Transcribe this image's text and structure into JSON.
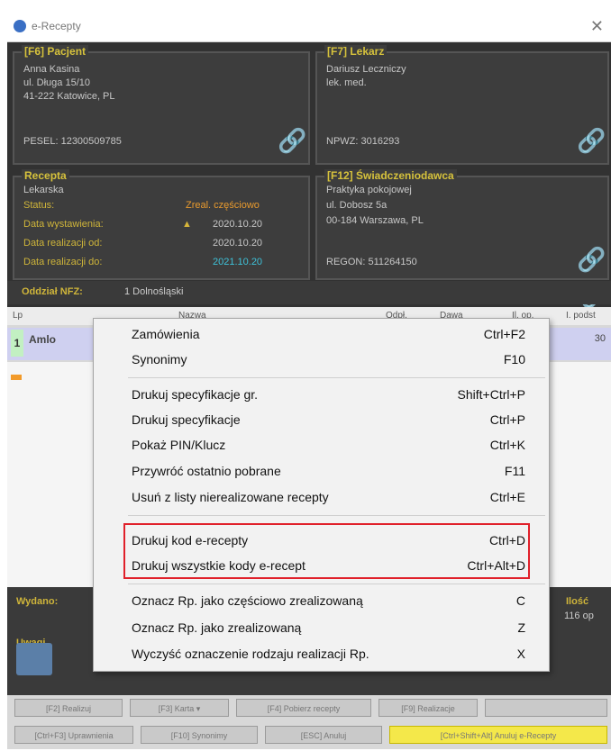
{
  "window": {
    "title": "e-Recepty",
    "close": "✕"
  },
  "patient": {
    "title": "[F6] Pacjent",
    "name": "Anna Kasina",
    "address1": "ul. Długa 15/10",
    "address2": "41-222 Katowice, PL",
    "pesel": "PESEL: 12300509785"
  },
  "doctor": {
    "title": "[F7] Lekarz",
    "name": "Dariusz Leczniczy",
    "role": "lek. med.",
    "npwz": "NPWZ: 3016293"
  },
  "prescription": {
    "title": "Recepta",
    "type": "Lekarska",
    "status_label": "Status:",
    "status_value": "Zreal. częściowo",
    "issued_label": "Data wystawienia:",
    "issued_value": "2020.10.20",
    "from_label": "Data realizacji od:",
    "from_value": "2020.10.20",
    "to_label": "Data realizacji do:",
    "to_value": "2021.10.20"
  },
  "provider": {
    "title": "[F12] Świadczeniodawca",
    "name": "Praktyka pokojowej",
    "street": "ul. Dobosz 5a",
    "city": "00-184 Warszawa, PL",
    "regon": "REGON: 511264150"
  },
  "branch": {
    "label": "Oddział NFZ:",
    "value": "1 Dolnośląski"
  },
  "list": {
    "headers": {
      "lp": "Lp",
      "name": "Nazwa",
      "odpl": "Odpł.",
      "dose": "Dawa",
      "ilosc": "Il. op.",
      "podst": "I. podst"
    },
    "row": {
      "num": "1",
      "name": "Amlo",
      "value": "30"
    }
  },
  "bottom": {
    "issued": "Wydano:",
    "notes": "Uwagi",
    "right_label": "Ilość",
    "right_value": "116 op"
  },
  "buttons_row1": [
    "[F2] Realizuj",
    "[F3] Karta ▾",
    "[F4] Pobierz recepty",
    "[F9] Realizacje"
  ],
  "buttons_row2": [
    "[Ctrl+F3] Uprawnienia",
    "[F10] Synonimy",
    "[ESC] Anuluj",
    "[Ctrl+Shift+Alt] Anuluj e-Recepty"
  ],
  "menu": {
    "items": [
      {
        "label": "Zamówienia",
        "shortcut": "Ctrl+F2"
      },
      {
        "label": "Synonimy",
        "shortcut": "F10"
      },
      {
        "label": "Drukuj specyfikacje gr.",
        "shortcut": "Shift+Ctrl+P"
      },
      {
        "label": "Drukuj specyfikacje",
        "shortcut": "Ctrl+P"
      },
      {
        "label": "Pokaż PIN/Klucz",
        "shortcut": "Ctrl+K"
      },
      {
        "label": "Przywróć ostatnio pobrane",
        "shortcut": "F11"
      },
      {
        "label": "Usuń z listy nierealizowane recepty",
        "shortcut": "Ctrl+E"
      },
      {
        "label": "Drukuj kod e-recepty",
        "shortcut": "Ctrl+D"
      },
      {
        "label": "Drukuj wszystkie kody e-recept",
        "shortcut": "Ctrl+Alt+D"
      },
      {
        "label": "Oznacz Rp. jako częściowo zrealizowaną",
        "shortcut": "C"
      },
      {
        "label": "Oznacz Rp. jako zrealizowaną",
        "shortcut": "Z"
      },
      {
        "label": "Wyczyść oznaczenie rodzaju realizacji Rp.",
        "shortcut": "X"
      }
    ],
    "highlight_color": "#e0202a"
  },
  "colors": {
    "panel_bg": "#3d3d3d",
    "label": "#cfb53a",
    "link": "#4cb24c",
    "menu_bg": "#f2f2f2"
  }
}
